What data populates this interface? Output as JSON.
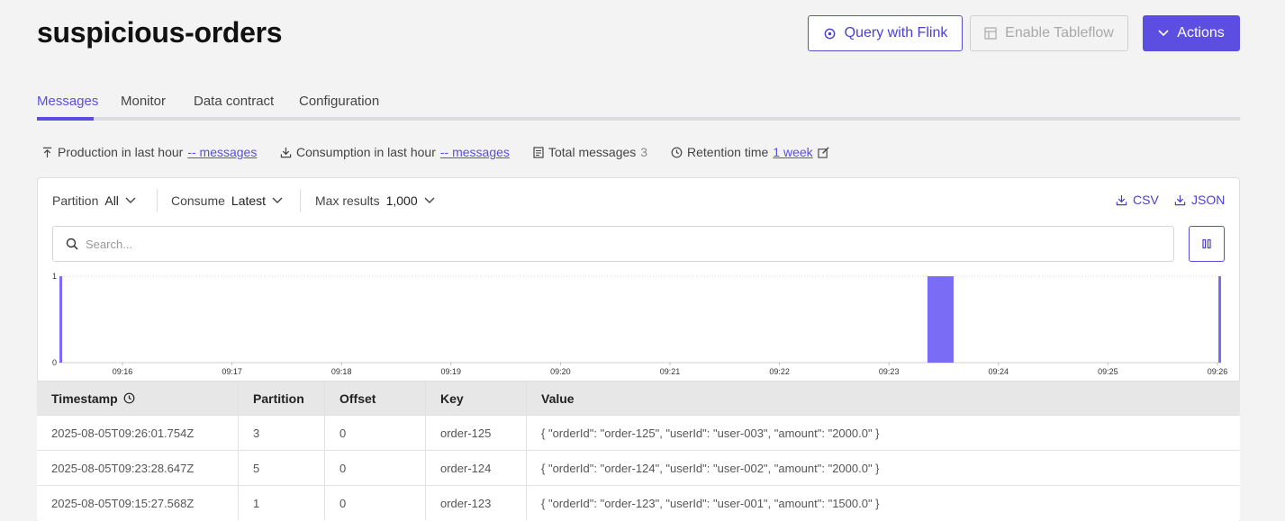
{
  "page": {
    "title": "suspicious-orders"
  },
  "buttons": {
    "query_flink": "Query with Flink",
    "enable_tableflow": "Enable Tableflow",
    "actions": "Actions"
  },
  "tabs": [
    {
      "label": "Messages",
      "active": true
    },
    {
      "label": "Monitor",
      "active": false
    },
    {
      "label": "Data contract",
      "active": false
    },
    {
      "label": "Configuration",
      "active": false
    }
  ],
  "stats": {
    "production_label": "Production in last hour",
    "production_value": "-- messages",
    "consumption_label": "Consumption in last hour",
    "consumption_value": "-- messages",
    "total_label": "Total messages",
    "total_value": "3",
    "retention_label": "Retention time",
    "retention_value": "1 week"
  },
  "filters": {
    "partition_label": "Partition",
    "partition_value": "All",
    "consume_label": "Consume",
    "consume_value": "Latest",
    "max_label": "Max results",
    "max_value": "1,000"
  },
  "downloads": {
    "csv": "CSV",
    "json": "JSON"
  },
  "search": {
    "placeholder": "Search...",
    "value": ""
  },
  "colors": {
    "accent": "#5b4ee0",
    "bar": "#7b6cf6"
  },
  "chart_data": {
    "type": "bar",
    "x_ticks": [
      "09:16",
      "09:17",
      "09:18",
      "09:19",
      "09:20",
      "09:21",
      "09:22",
      "09:23",
      "09:24",
      "09:25",
      "09:26"
    ],
    "y_ticks": [
      "0",
      "1"
    ],
    "ylim": [
      0,
      1
    ],
    "bars": [
      {
        "time": "09:15:27",
        "value": 1
      },
      {
        "time": "09:23:28",
        "value": 1
      },
      {
        "time": "09:26:01",
        "value": 1
      }
    ]
  },
  "table": {
    "columns": [
      "Timestamp",
      "Partition",
      "Offset",
      "Key",
      "Value"
    ],
    "rows": [
      [
        "2025-08-05T09:26:01.754Z",
        "3",
        "0",
        "order-125",
        "{ \"orderId\": \"order-125\", \"userId\": \"user-003\", \"amount\": \"2000.0\" }"
      ],
      [
        "2025-08-05T09:23:28.647Z",
        "5",
        "0",
        "order-124",
        "{ \"orderId\": \"order-124\", \"userId\": \"user-002\", \"amount\": \"2000.0\" }"
      ],
      [
        "2025-08-05T09:15:27.568Z",
        "1",
        "0",
        "order-123",
        "{ \"orderId\": \"order-123\", \"userId\": \"user-001\", \"amount\": \"1500.0\" }"
      ]
    ]
  }
}
